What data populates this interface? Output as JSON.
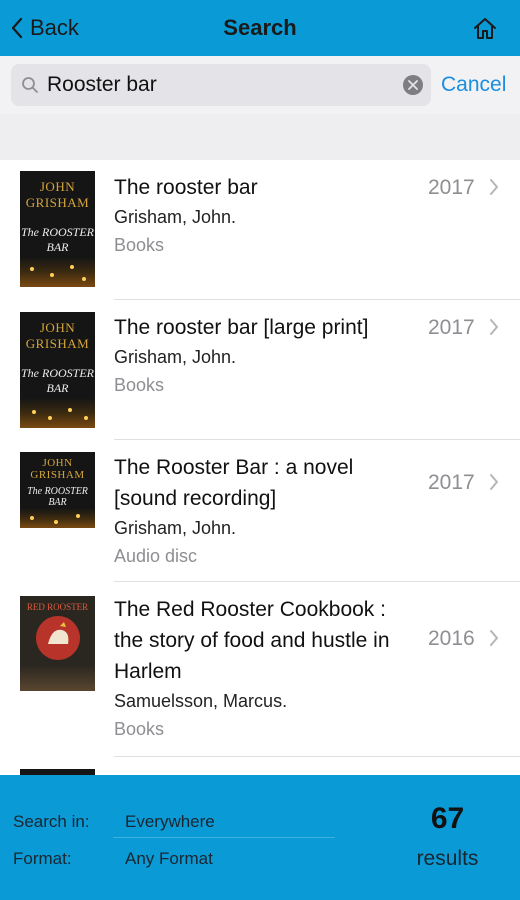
{
  "nav": {
    "back_label": "Back",
    "title": "Search"
  },
  "search": {
    "query": "Rooster bar",
    "cancel_label": "Cancel"
  },
  "results": [
    {
      "title": "The rooster bar",
      "author": "Grisham, John.",
      "format": "Books",
      "year": "2017",
      "cover_author": "JOHN GRISHAM",
      "cover_title": "The ROOSTER BAR"
    },
    {
      "title": "The rooster bar [large print]",
      "author": "Grisham, John.",
      "format": "Books",
      "year": "2017",
      "cover_author": "JOHN GRISHAM",
      "cover_title": "The ROOSTER BAR"
    },
    {
      "title": "The Rooster Bar : a novel [sound recording]",
      "author": "Grisham, John.",
      "format": "Audio disc",
      "year": "2017",
      "cover_author": "JOHN GRISHAM",
      "cover_title": "The ROOSTER BAR"
    },
    {
      "title": "The Red Rooster Cookbook : the story of food and hustle in Harlem",
      "author": "Samuelsson, Marcus.",
      "format": "Books",
      "year": "2016",
      "cover_title": "RED ROOSTER"
    }
  ],
  "footer": {
    "search_in_label": "Search in:",
    "search_in_value": "Everywhere",
    "format_label": "Format:",
    "format_value": "Any Format",
    "count": "67",
    "results_label": "results"
  },
  "colors": {
    "nav_bg": "#0a9ad6",
    "accent": "#1a8ee0"
  },
  "icons": [
    "chevron-left-icon",
    "home-icon",
    "search-icon",
    "clear-icon",
    "chevron-right-icon"
  ]
}
